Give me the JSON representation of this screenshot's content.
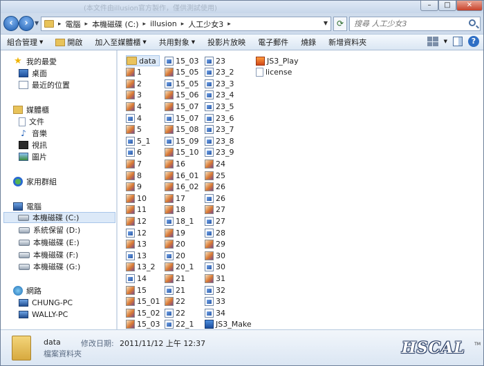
{
  "window": {
    "title_faint": "(本文件由illusion官方製作，僅供測試使用)"
  },
  "address": {
    "crumbs": [
      "電腦",
      "本機磁碟 (C:)",
      "illusion",
      "人工少女3"
    ],
    "search_placeholder": "搜尋 人工少女3"
  },
  "toolbar": {
    "organize": "組合管理",
    "open": "開啟",
    "include_library": "加入至媒體櫃",
    "share": "共用對象",
    "slideshow": "投影片放映",
    "email": "電子郵件",
    "burn": "燒錄",
    "new_folder": "新增資料夾"
  },
  "nav": {
    "favorites": "我的最愛",
    "desktop": "桌面",
    "recent": "最近的位置",
    "libraries": "媒體櫃",
    "documents": "文件",
    "music": "音樂",
    "videos": "視訊",
    "pictures": "圖片",
    "homegroup": "家用群組",
    "computer": "電腦",
    "drive_c": "本機磁碟 (C:)",
    "drive_d": "系統保留 (D:)",
    "drive_e": "本機磁碟 (E:)",
    "drive_f": "本機磁碟 (F:)",
    "drive_g": "本機磁碟 (G:)",
    "network": "網路",
    "net_pc1": "CHUNG-PC",
    "net_pc2": "WALLY-PC"
  },
  "files": {
    "col1": [
      {
        "name": "data",
        "icon": "folder",
        "selected": true
      },
      {
        "name": "1",
        "icon": "image"
      },
      {
        "name": "2",
        "icon": "image"
      },
      {
        "name": "3",
        "icon": "image"
      },
      {
        "name": "4",
        "icon": "image"
      },
      {
        "name": "4",
        "icon": "exe"
      },
      {
        "name": "5",
        "icon": "image"
      },
      {
        "name": "5_1",
        "icon": "exe"
      },
      {
        "name": "6",
        "icon": "exe"
      },
      {
        "name": "7",
        "icon": "image"
      },
      {
        "name": "8",
        "icon": "image"
      },
      {
        "name": "9",
        "icon": "image"
      },
      {
        "name": "10",
        "icon": "image"
      },
      {
        "name": "11",
        "icon": "image"
      },
      {
        "name": "12",
        "icon": "image"
      },
      {
        "name": "12",
        "icon": "exe"
      },
      {
        "name": "13",
        "icon": "image"
      },
      {
        "name": "13",
        "icon": "exe"
      },
      {
        "name": "13_2",
        "icon": "image"
      },
      {
        "name": "14",
        "icon": "exe"
      },
      {
        "name": "15",
        "icon": "image"
      },
      {
        "name": "15_01",
        "icon": "image"
      },
      {
        "name": "15_02",
        "icon": "image"
      },
      {
        "name": "15_03",
        "icon": "image"
      }
    ],
    "col2": [
      {
        "name": "15_03",
        "icon": "exe"
      },
      {
        "name": "15_05",
        "icon": "image"
      },
      {
        "name": "15_05",
        "icon": "exe"
      },
      {
        "name": "15_06",
        "icon": "image"
      },
      {
        "name": "15_07",
        "icon": "image"
      },
      {
        "name": "15_07",
        "icon": "exe"
      },
      {
        "name": "15_08",
        "icon": "image"
      },
      {
        "name": "15_09",
        "icon": "exe"
      },
      {
        "name": "15_10",
        "icon": "image"
      },
      {
        "name": "16",
        "icon": "image"
      },
      {
        "name": "16_01",
        "icon": "image"
      },
      {
        "name": "16_02",
        "icon": "image"
      },
      {
        "name": "17",
        "icon": "image"
      },
      {
        "name": "18",
        "icon": "image"
      },
      {
        "name": "18_1",
        "icon": "exe"
      },
      {
        "name": "19",
        "icon": "image"
      },
      {
        "name": "20",
        "icon": "image"
      },
      {
        "name": "20",
        "icon": "exe"
      },
      {
        "name": "20_1",
        "icon": "image"
      },
      {
        "name": "21",
        "icon": "image"
      },
      {
        "name": "21",
        "icon": "exe"
      },
      {
        "name": "22",
        "icon": "image"
      },
      {
        "name": "22",
        "icon": "exe"
      },
      {
        "name": "22_1",
        "icon": "exe"
      }
    ],
    "col3": [
      {
        "name": "23",
        "icon": "exe"
      },
      {
        "name": "23_2",
        "icon": "exe"
      },
      {
        "name": "23_3",
        "icon": "exe"
      },
      {
        "name": "23_4",
        "icon": "exe"
      },
      {
        "name": "23_5",
        "icon": "exe"
      },
      {
        "name": "23_6",
        "icon": "exe"
      },
      {
        "name": "23_7",
        "icon": "exe"
      },
      {
        "name": "23_8",
        "icon": "exe"
      },
      {
        "name": "23_9",
        "icon": "exe"
      },
      {
        "name": "24",
        "icon": "image"
      },
      {
        "name": "25",
        "icon": "image"
      },
      {
        "name": "26",
        "icon": "image"
      },
      {
        "name": "26",
        "icon": "exe"
      },
      {
        "name": "27",
        "icon": "image"
      },
      {
        "name": "27",
        "icon": "exe"
      },
      {
        "name": "28",
        "icon": "exe"
      },
      {
        "name": "29",
        "icon": "image"
      },
      {
        "name": "30",
        "icon": "image"
      },
      {
        "name": "30",
        "icon": "exe"
      },
      {
        "name": "31",
        "icon": "image"
      },
      {
        "name": "32",
        "icon": "exe"
      },
      {
        "name": "33",
        "icon": "exe"
      },
      {
        "name": "34",
        "icon": "exe"
      },
      {
        "name": "JS3_Make",
        "icon": "app"
      }
    ],
    "col4": [
      {
        "name": "JS3_Play",
        "icon": "play"
      },
      {
        "name": "license",
        "icon": "text"
      }
    ]
  },
  "details": {
    "name": "data",
    "modified_label": "修改日期:",
    "modified_value": "2011/11/12 上午 12:37",
    "type": "檔案資料夾"
  },
  "watermark": {
    "text": "HSCAL",
    "tm": "TM"
  }
}
